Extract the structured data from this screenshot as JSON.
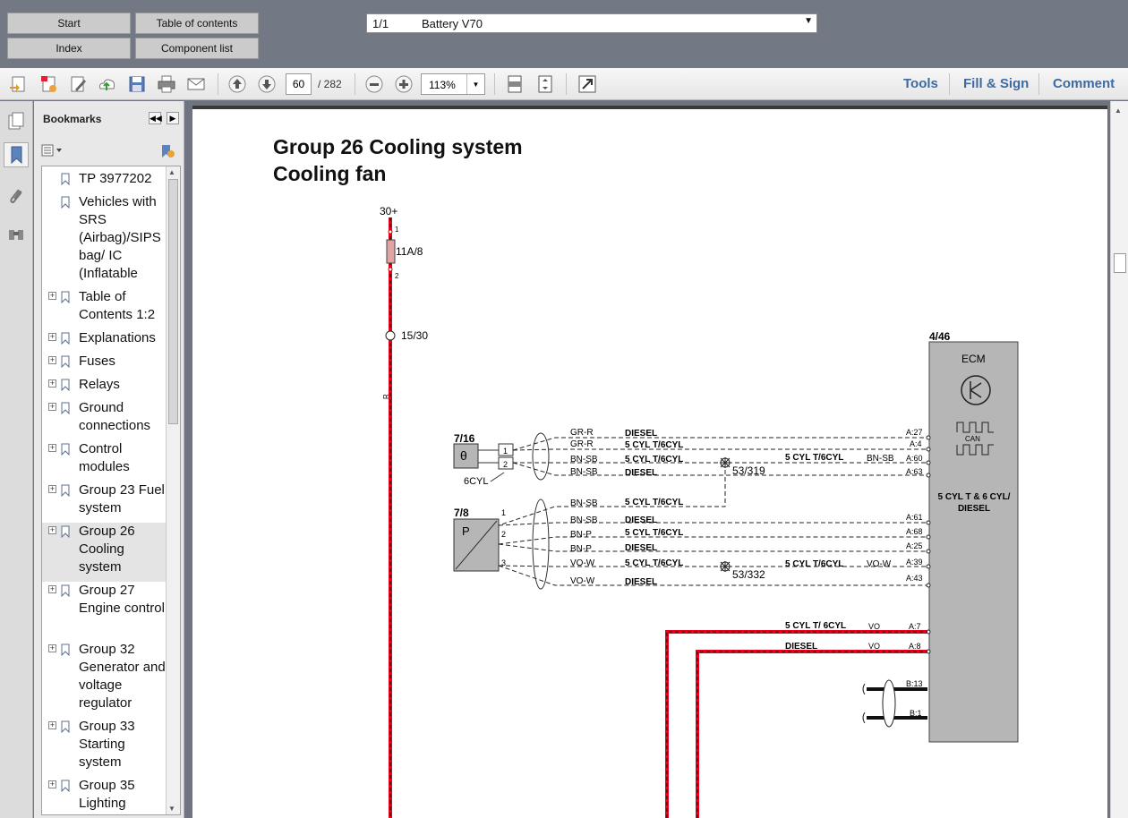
{
  "nav": {
    "start_label": "Start",
    "toc_label": "Table of contents",
    "index_label": "Index",
    "components_label": "Component list"
  },
  "doc_select": {
    "page": "1/1",
    "name": "Battery V70"
  },
  "toolbar": {
    "page_current": "60",
    "page_total": "/  282",
    "zoom": "113%",
    "tools_label": "Tools",
    "fill_sign_label": "Fill & Sign",
    "comment_label": "Comment"
  },
  "sidebar": {
    "title": "Bookmarks",
    "items": [
      {
        "label": "TP 3977202",
        "expandable": false
      },
      {
        "label": "Vehicles with SRS (Airbag)/SIPS bag/ IC (Inflatable",
        "expandable": false
      },
      {
        "label": "Table of Contents 1:2",
        "expandable": true
      },
      {
        "label": "Explanations",
        "expandable": true
      },
      {
        "label": "Fuses",
        "expandable": true
      },
      {
        "label": "Relays",
        "expandable": true
      },
      {
        "label": "Ground connections",
        "expandable": true
      },
      {
        "label": "Control modules",
        "expandable": true
      },
      {
        "label": "Group 23 Fuel system",
        "expandable": true
      },
      {
        "label": "Group 26 Cooling system",
        "expandable": true,
        "selected": true
      },
      {
        "label": "Group 27 Engine control",
        "expandable": true
      },
      {
        "label": "Group 32 Generator and voltage regulator",
        "expandable": true
      },
      {
        "label": "Group 33 Starting system",
        "expandable": true
      },
      {
        "label": "Group 35 Lighting",
        "expandable": true
      }
    ]
  },
  "page": {
    "title1": "Group 26 Cooling system",
    "title2": "Cooling fan"
  },
  "diagram": {
    "supply": "30+",
    "fuse_pin1": "1",
    "fuse_pin2": "2",
    "fuse": "11A/8",
    "splice": "15/30",
    "wire_r": "R",
    "comp_716": "7/16",
    "comp_78": "7/8",
    "theta": "θ",
    "p_label": "P",
    "pin1": "1",
    "pin2": "2",
    "pin3": "3",
    "cyl6": "6CYL",
    "ecm_id": "4/46",
    "ecm_name": "ECM",
    "can": "CAN",
    "ecm_desc1": "5 CYL T & 6 CYL/",
    "ecm_desc2": "DIESEL",
    "splice_319": "53/319",
    "splice_332": "53/332",
    "row1_color": "GR-R",
    "row1_tag": "DIESEL",
    "row1_pin": "A:27",
    "row2_color": "GR-R",
    "row2_tag": "5 CYL T/6CYL",
    "row2_pin": "A:4",
    "row3_color": "BN-SB",
    "row3_tag": "5 CYL T/6CYL",
    "row3_tag2": "5 CYL T/6CYL",
    "row3_color2": "BN-SB",
    "row3_pin": "A:60",
    "row4_color": "BN-SB",
    "row4_tag": "DIESEL",
    "row4_pin": "A:63",
    "row5_color": "BN-SB",
    "row5_tag": "5 CYL T/6CYL",
    "row6_color": "BN-SB",
    "row6_tag": "DIESEL",
    "row6_pin": "A:61",
    "row7_color": "BN-P",
    "row7_tag": "5 CYL T/6CYL",
    "row7_pin": "A:68",
    "row8_color": "BN-P",
    "row8_tag": "DIESEL",
    "row8_pin": "A:25",
    "row9_color": "VO-W",
    "row9_tag": "5 CYL T/6CYL",
    "row9_tag2": "5 CYL T/6CYL",
    "row9_color2": "VO-W",
    "row9_pin": "A:39",
    "row10_color": "VO-W",
    "row10_tag": "DIESEL",
    "row10_pin": "A:43",
    "row11_tag": "5 CYL T/ 6CYL",
    "row11_color": "VO",
    "row11_pin": "A:7",
    "row12_tag": "DIESEL",
    "row12_color": "VO",
    "row12_pin": "A:8",
    "b13": "B:13",
    "b1": "B:1"
  },
  "colors": {
    "wire_red": "#e8001c",
    "accent": "#3c6aa3",
    "panel": "#e8e8e8"
  }
}
